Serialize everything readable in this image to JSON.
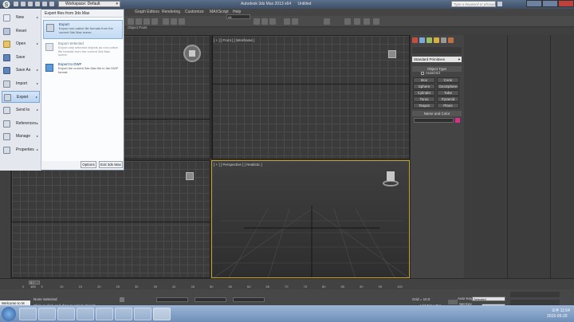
{
  "titlebar": {
    "workspace": "Workspace: Default",
    "app_title": "Autodesk 3ds Max 2013 x64",
    "file_title": "Untitled",
    "search_placeholder": "Type a keyword or phrase"
  },
  "menubar": {
    "items": [
      "Graph Editors",
      "Rendering",
      "Customize",
      "MAXScript",
      "Help"
    ]
  },
  "toolbar": {
    "selection_filter": "All",
    "grid_label": "Object Paint"
  },
  "app_menu": {
    "items": [
      {
        "label": "New",
        "has_sub": true
      },
      {
        "label": "Reset",
        "has_sub": false
      },
      {
        "label": "Open",
        "has_sub": true
      },
      {
        "label": "Save",
        "has_sub": false
      },
      {
        "label": "Save As",
        "has_sub": true
      },
      {
        "label": "Import",
        "has_sub": true
      },
      {
        "label": "Export",
        "has_sub": true
      },
      {
        "label": "Send to",
        "has_sub": true
      },
      {
        "label": "References",
        "has_sub": true
      },
      {
        "label": "Manage",
        "has_sub": true
      },
      {
        "label": "Properties",
        "has_sub": true
      }
    ],
    "submenu_title": "Export files from 3ds Max",
    "entries": [
      {
        "title": "Export",
        "desc": "Export non-native file formats from the current 3ds Max scene."
      },
      {
        "title": "Export Selected",
        "desc": "Export only selected objects as non-native file formats from the current 3ds Max scene."
      },
      {
        "title": "Export to DWF",
        "desc": "Export the current 3ds Max file in the DWF format."
      }
    ],
    "options_button": "Options",
    "exit_button": "Exit 3ds Max"
  },
  "viewports": {
    "front_label": "[ + ] [ Front ] [ Wireframe ]",
    "perspective_label": "[ + ] [ Perspective ] [ Realistic ]"
  },
  "command_panel": {
    "dropdown": "Standard Primitives",
    "object_type_title": "Object Type",
    "autogrid": "AutoGrid",
    "buttons": [
      "Box",
      "Cone",
      "Sphere",
      "GeoSphere",
      "Cylinder",
      "Tube",
      "Torus",
      "Pyramid",
      "Teapot",
      "Plane"
    ],
    "name_color_title": "Name and Color"
  },
  "timeline": {
    "frame_counter": "0 / 100",
    "ticks": [
      "0",
      "5",
      "10",
      "15",
      "20",
      "25",
      "30",
      "35",
      "40",
      "45",
      "50",
      "55",
      "60",
      "65",
      "70",
      "75",
      "80",
      "85",
      "90",
      "95",
      "100"
    ]
  },
  "status": {
    "maxscript": "Welcome to M",
    "none_selected": "None Selected",
    "prompt": "Click or click-and-drag to select objects",
    "grid": "Grid = 10.0",
    "add_time_tag": "Add Time Tag",
    "auto_key": "Auto Key",
    "set_key": "Set Key",
    "selected": "Selected",
    "key_filters": "Key Filters..."
  },
  "taskbar": {
    "time": "오후 11:54",
    "date": "2015-05-20"
  },
  "colors": {
    "accent": "#c8a12a",
    "swatch": "#d8308a"
  }
}
